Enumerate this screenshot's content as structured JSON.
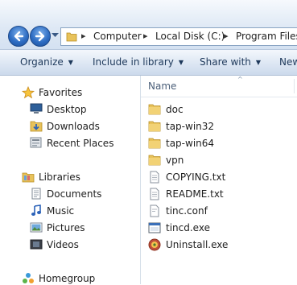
{
  "breadcrumb": [
    "Computer",
    "Local Disk (C:)",
    "Program Files"
  ],
  "toolbar": {
    "organize": "Organize",
    "include": "Include in library",
    "share": "Share with",
    "new": "New"
  },
  "navpane": {
    "favorites": {
      "label": "Favorites",
      "items": [
        "Desktop",
        "Downloads",
        "Recent Places"
      ]
    },
    "libraries": {
      "label": "Libraries",
      "items": [
        "Documents",
        "Music",
        "Pictures",
        "Videos"
      ]
    },
    "homegroup": "Homegroup"
  },
  "content": {
    "column_name": "Name",
    "files": [
      {
        "name": "doc",
        "icon": "folder-icon"
      },
      {
        "name": "tap-win32",
        "icon": "folder-icon"
      },
      {
        "name": "tap-win64",
        "icon": "folder-icon"
      },
      {
        "name": "vpn",
        "icon": "folder-icon"
      },
      {
        "name": "COPYING.txt",
        "icon": "text-file-icon"
      },
      {
        "name": "README.txt",
        "icon": "text-file-icon"
      },
      {
        "name": "tinc.conf",
        "icon": "config-file-icon"
      },
      {
        "name": "tincd.exe",
        "icon": "application-icon"
      },
      {
        "name": "Uninstall.exe",
        "icon": "uninstall-icon"
      }
    ]
  },
  "colors": {
    "accent": "#2f6ec4",
    "folder": "#e8c25a",
    "toolbar_text": "#1e395b"
  }
}
